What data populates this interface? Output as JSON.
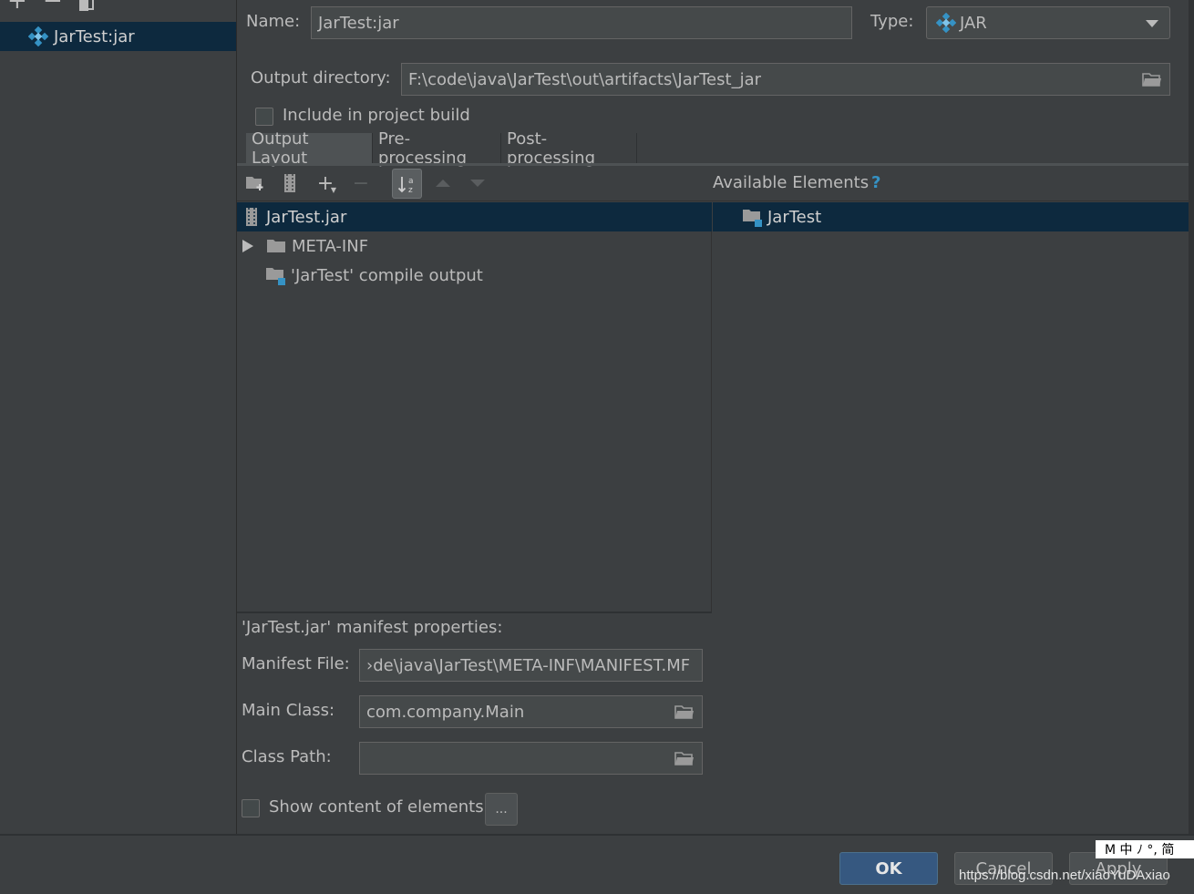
{
  "sidebar": {
    "toolbar": {
      "add": "+",
      "remove": "−"
    },
    "items": [
      {
        "label": "JarTest:jar",
        "selected": true
      }
    ]
  },
  "form": {
    "name_label": "Name:",
    "name_value": "JarTest:jar",
    "type_label": "Type:",
    "type_value": "JAR",
    "output_dir_label": "Output directory:",
    "output_dir_value": "F:\\code\\java\\JarTest\\out\\artifacts\\JarTest_jar",
    "include_build_label": "Include in project build",
    "include_build_checked": false
  },
  "tabs": [
    {
      "label": "Output Layout",
      "active": true
    },
    {
      "label": "Pre-processing",
      "active": false
    },
    {
      "label": "Post-processing",
      "active": false
    }
  ],
  "layout": {
    "available_label": "Available Elements",
    "help_glyph": "?",
    "tree": [
      {
        "label": "JarTest.jar",
        "selected": true
      },
      {
        "label": "META-INF",
        "expandable": true
      },
      {
        "label": "'JarTest' compile output"
      }
    ],
    "available": [
      {
        "label": "JarTest"
      }
    ]
  },
  "manifest": {
    "title": "'JarTest.jar' manifest properties:",
    "file_label": "Manifest File:",
    "file_value": "›de\\java\\JarTest\\META-INF\\MANIFEST.MF",
    "main_class_label": "Main Class:",
    "main_class_value": "com.company.Main",
    "class_path_label": "Class Path:",
    "class_path_value": ""
  },
  "show_content_label": "Show content of elements",
  "ellipsis": "...",
  "buttons": {
    "ok": "OK",
    "cancel": "Cancel",
    "apply": "Apply"
  },
  "ime": "M 中 ﾉ °, 简",
  "watermark": "https://blog.csdn.net/xiaoYuDAxiao",
  "colors": {
    "selection": "#0d293e",
    "ok_button": "#365880",
    "background": "#3c3f41",
    "field": "#45494a",
    "accent_blue": "#3592c4"
  }
}
